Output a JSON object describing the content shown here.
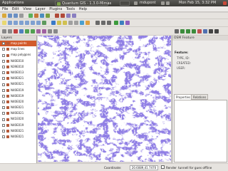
{
  "top_panel": {
    "app_menu": "Applications",
    "window_title": "Quantum GIS - 1.3.0-Mimas",
    "user": "mdupont",
    "clock": "Mon Feb 15, 3:32 PM"
  },
  "menu": [
    "File",
    "Edit",
    "View",
    "Layer",
    "Plugins",
    "Tools",
    "Help"
  ],
  "layers": {
    "title": "Layers",
    "items": [
      {
        "name": "map points",
        "selected": true
      },
      {
        "name": "map lines",
        "selected": false
      },
      {
        "name": "map polygons",
        "selected": false
      },
      {
        "name": "N40E010",
        "selected": false
      },
      {
        "name": "N39E010",
        "selected": false
      },
      {
        "name": "N40E013",
        "selected": false
      },
      {
        "name": "N40E021",
        "selected": false
      },
      {
        "name": "N40E021",
        "selected": false
      },
      {
        "name": "N40E019",
        "selected": false
      },
      {
        "name": "N40E019",
        "selected": false
      },
      {
        "name": "N40E020",
        "selected": false
      },
      {
        "name": "N40E021",
        "selected": false
      },
      {
        "name": "N40E021",
        "selected": false
      },
      {
        "name": "N41E020",
        "selected": false
      },
      {
        "name": "N40E019",
        "selected": false
      },
      {
        "name": "N40E021",
        "selected": false
      },
      {
        "name": "N40E021",
        "selected": false
      }
    ]
  },
  "osm_panel": {
    "title": "OSM Feature",
    "feature_label": "Feature:",
    "type_label": "TYPE, ID:",
    "created_label": "CREATED:",
    "user_label": "USER:",
    "tabs": [
      "Properties",
      "Relations"
    ]
  },
  "status": {
    "coordinate_label": "Coordinate:",
    "coordinate_value": "20.6089,41.7470",
    "render_label": "Render",
    "extra": "tunnell  for gues  offline"
  },
  "colors": {
    "map_fill": "#4736c7",
    "selected_layer": "#d25a2b"
  },
  "icons": [
    "pointer-icon",
    "pan-icon",
    "zoom-in-icon",
    "zoom-out-icon",
    "identify-icon",
    "measure-icon",
    "open-icon",
    "save-icon",
    "add-layer-icon",
    "osm-tools-icon"
  ]
}
